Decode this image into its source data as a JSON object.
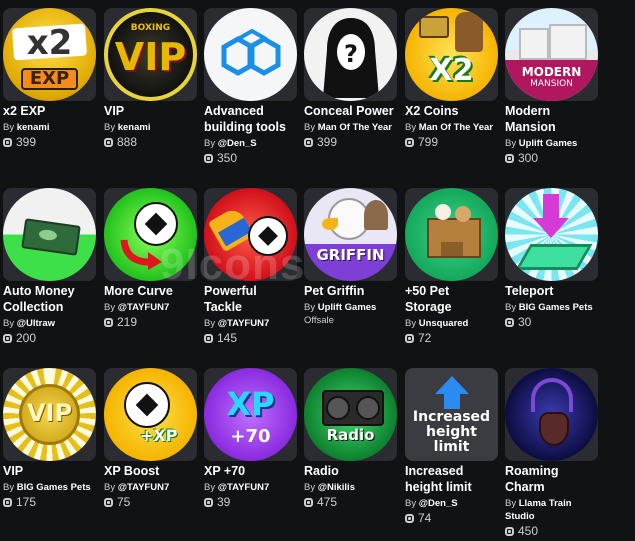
{
  "items": [
    {
      "name": "x2 EXP",
      "by": "By",
      "creator": "kenami",
      "price": "399",
      "icon_label": "x2",
      "icon_sub": "EXP",
      "icon": "x2-exp-icon"
    },
    {
      "name": "VIP",
      "by": "By",
      "creator": "kenami",
      "price": "888",
      "icon_label": "VIP",
      "icon_sub": "BOXING",
      "icon": "boxing-vip-icon"
    },
    {
      "name": "Advanced building tools",
      "by": "By",
      "creator": "@Den_S",
      "price": "350",
      "icon": "building-blocks-icon"
    },
    {
      "name": "Conceal Power",
      "by": "By",
      "creator": "Man Of The Year",
      "price": "399",
      "icon": "hooded-figure-icon"
    },
    {
      "name": "X2 Coins",
      "by": "By",
      "creator": "Man Of The Year",
      "price": "799",
      "icon_label": "X2",
      "icon": "x2-coins-icon"
    },
    {
      "name": "Modern Mansion",
      "by": "By",
      "creator": "Uplift Games",
      "price": "300",
      "icon_label": "MODERN",
      "icon_sub": "MANSION",
      "icon": "mansion-icon"
    },
    {
      "name": "Auto Money Collection",
      "by": "By",
      "creator": "@Ultraw",
      "price": "200",
      "icon": "money-icon"
    },
    {
      "name": "More Curve",
      "by": "By",
      "creator": "@TAYFUN7",
      "price": "219",
      "icon": "soccer-curve-icon"
    },
    {
      "name": "Powerful Tackle",
      "by": "By",
      "creator": "@TAYFUN7",
      "price": "145",
      "icon": "soccer-tackle-icon"
    },
    {
      "name": "Pet Griffin",
      "by": "By",
      "creator": "Uplift Games",
      "status": "Offsale",
      "icon_label": "GRIFFIN",
      "icon": "griffin-icon"
    },
    {
      "name": "+50 Pet Storage",
      "by": "By",
      "creator": "Unsquared",
      "price": "72",
      "icon": "pet-box-icon"
    },
    {
      "name": "Teleport",
      "by": "By",
      "creator": "BIG Games Pets",
      "price": "30",
      "icon": "teleport-arrow-icon"
    },
    {
      "name": "VIP",
      "by": "By",
      "creator": "BIG Games Pets",
      "price": "175",
      "icon_label": "VIP",
      "icon": "gold-vip-icon"
    },
    {
      "name": "XP Boost",
      "by": "By",
      "creator": "@TAYFUN7",
      "price": "75",
      "icon_label": "+XP",
      "icon": "soccer-xp-icon"
    },
    {
      "name": "XP +70",
      "by": "By",
      "creator": "@TAYFUN7",
      "price": "39",
      "icon_label": "XP",
      "icon_sub": "+70",
      "icon": "xp-70-icon"
    },
    {
      "name": "Radio",
      "by": "By",
      "creator": "@Nikilis",
      "price": "475",
      "icon_label": "Radio",
      "icon": "radio-icon"
    },
    {
      "name": "Increased height limit",
      "by": "By",
      "creator": "@Den_S",
      "price": "74",
      "icon_label": "Increased height limit",
      "icon": "up-arrow-icon"
    },
    {
      "name": "Roaming Charm",
      "by": "By",
      "creator": "Llama Train Studio",
      "price": "450",
      "icon": "charm-necklace-icon"
    }
  ],
  "watermark": "9Icons"
}
